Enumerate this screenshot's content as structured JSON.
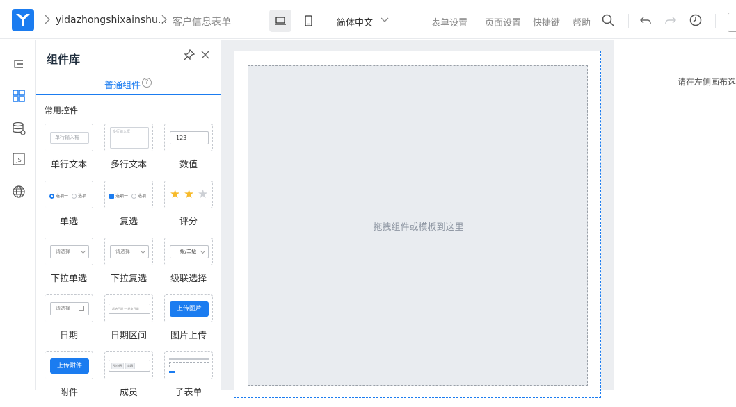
{
  "header": {
    "app_name": "yidazhongshixainshu...",
    "form_name": "客户信息表单",
    "language": "简体中文",
    "menu": [
      "表单设置",
      "页面设置",
      "快捷键",
      "帮助"
    ]
  },
  "panel": {
    "title": "组件库",
    "tab": "普通组件",
    "help": "?",
    "section": "常用控件",
    "components": [
      {
        "label": "单行文本",
        "preview": "单行输入框"
      },
      {
        "label": "多行文本",
        "preview": "多行输入框"
      },
      {
        "label": "数值",
        "preview": "123"
      },
      {
        "label": "单选",
        "preview": [
          "选项一",
          "选项二"
        ]
      },
      {
        "label": "复选",
        "preview": [
          "选项一",
          "选项二"
        ]
      },
      {
        "label": "评分",
        "preview": "3 stars, 2 filled"
      },
      {
        "label": "下拉单选",
        "preview": "请选择"
      },
      {
        "label": "下拉复选",
        "preview": "请选择"
      },
      {
        "label": "级联选择",
        "preview": "一级/二级"
      },
      {
        "label": "日期",
        "preview": "请选择"
      },
      {
        "label": "日期区间",
        "preview": [
          "起始日期",
          "结束日期"
        ]
      },
      {
        "label": "图片上传",
        "preview": "上传图片"
      },
      {
        "label": "附件",
        "preview": "上传附件"
      },
      {
        "label": "成员",
        "preview": [
          "张小明",
          "李四"
        ]
      },
      {
        "label": "子表单",
        "preview": ""
      }
    ]
  },
  "canvas": {
    "hint": "拖拽组件或模板到这里"
  },
  "right": {
    "hint": "请在左侧画布选"
  },
  "colors": {
    "accent": "#1b7cf0",
    "star": "#f7ba2a"
  }
}
